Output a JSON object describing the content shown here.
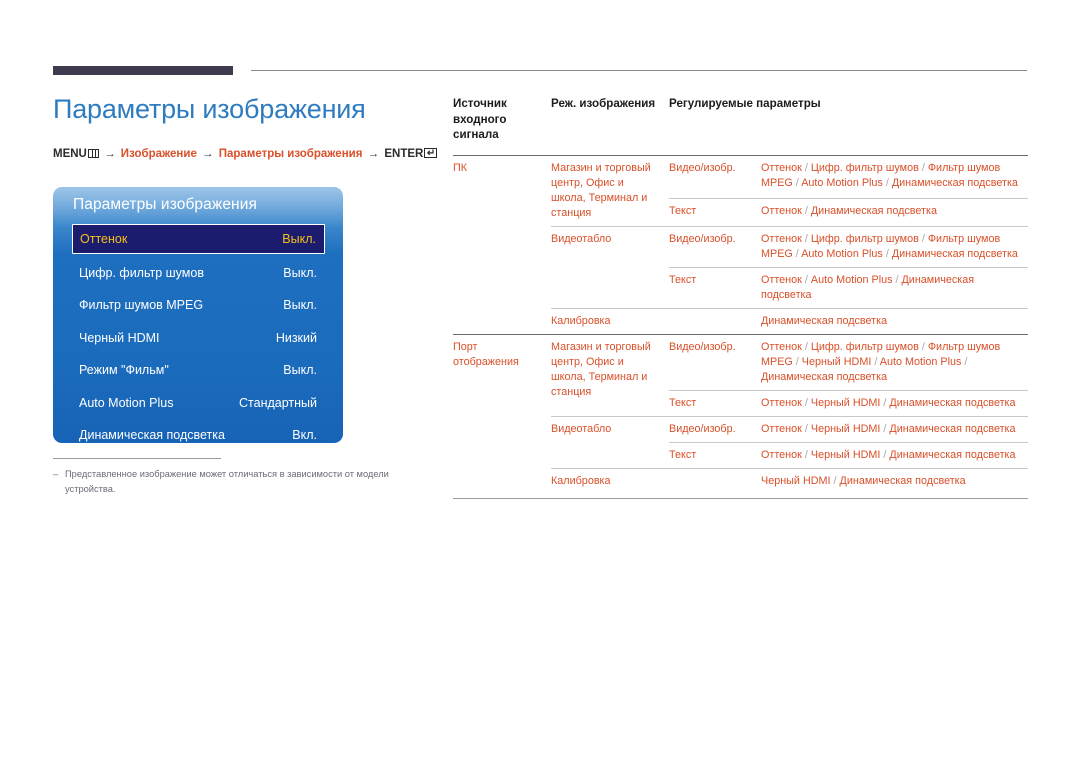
{
  "page": {
    "title": "Параметры изображения",
    "breadcrumb": {
      "menu_label": "MENU",
      "arrow": "→",
      "item1": "Изображение",
      "item2": "Параметры изображения",
      "enter_label": "ENTER"
    },
    "footnote_dash": "‒",
    "footnote": "Представленное изображение может отличаться в зависимости от модели устройства.",
    "colors": {
      "title_blue": "#2e7cbf",
      "accent_orange": "#d9502a",
      "osd_blue": "#1b6bbd",
      "osd_selected_bg": "#1c1c6e",
      "osd_selected_text": "#f3c01b",
      "rule_dark": "#403a4f"
    }
  },
  "osd": {
    "title": "Параметры изображения",
    "rows": [
      {
        "label": "Оттенок",
        "value": "Выкл.",
        "selected": true
      },
      {
        "label": "Цифр. фильтр шумов",
        "value": "Выкл.",
        "selected": false
      },
      {
        "label": "Фильтр шумов MPEG",
        "value": "Выкл.",
        "selected": false
      },
      {
        "label": "Черный HDMI",
        "value": "Низкий",
        "selected": false
      },
      {
        "label": "Режим \"Фильм\"",
        "value": "Выкл.",
        "selected": false
      },
      {
        "label": "Auto Motion Plus",
        "value": "Стандартный",
        "selected": false
      },
      {
        "label": "Динамическая подсветка",
        "value": "Вкл.",
        "selected": false
      }
    ]
  },
  "table": {
    "headers": {
      "source": "Источник входного сигнала",
      "mode": "Реж. изображения",
      "params": "Регулируемые параметры"
    },
    "groups": [
      {
        "source": "ПК",
        "modes": [
          {
            "name": "Магазин и торговый центр, Офис и школа, Терминал и станция",
            "subrows": [
              {
                "sub": "Видео/изобр.",
                "params": "Оттенок / Цифр. фильтр шумов / Фильтр шумов MPEG / Auto Motion Plus / Динамическая подсветка"
              },
              {
                "sub": "Текст",
                "params": "Оттенок / Динамическая подсветка"
              }
            ]
          },
          {
            "name": "Видеотабло",
            "subrows": [
              {
                "sub": "Видео/изобр.",
                "params": "Оттенок / Цифр. фильтр шумов / Фильтр шумов MPEG / Auto Motion Plus / Динамическая подсветка"
              },
              {
                "sub": "Текст",
                "params": "Оттенок / Auto Motion Plus / Динамическая подсветка"
              }
            ]
          },
          {
            "name": "Калибровка",
            "subrows": [
              {
                "sub": "",
                "params": "Динамическая подсветка"
              }
            ]
          }
        ]
      },
      {
        "source": "Порт отображения",
        "modes": [
          {
            "name": "Магазин и торговый центр, Офис и школа, Терминал и станция",
            "subrows": [
              {
                "sub": "Видео/изобр.",
                "params": "Оттенок / Цифр. фильтр шумов / Фильтр шумов MPEG / Черный HDMI / Auto Motion Plus / Динамическая подсветка"
              },
              {
                "sub": "Текст",
                "params": "Оттенок / Черный HDMI / Динамическая подсветка"
              }
            ]
          },
          {
            "name": "Видеотабло",
            "subrows": [
              {
                "sub": "Видео/изобр.",
                "params": "Оттенок / Черный HDMI / Динамическая подсветка"
              },
              {
                "sub": "Текст",
                "params": "Оттенок / Черный HDMI / Динамическая подсветка"
              }
            ]
          },
          {
            "name": "Калибровка",
            "subrows": [
              {
                "sub": "",
                "params": "Черный HDMI / Динамическая подсветка"
              }
            ]
          }
        ]
      }
    ]
  }
}
